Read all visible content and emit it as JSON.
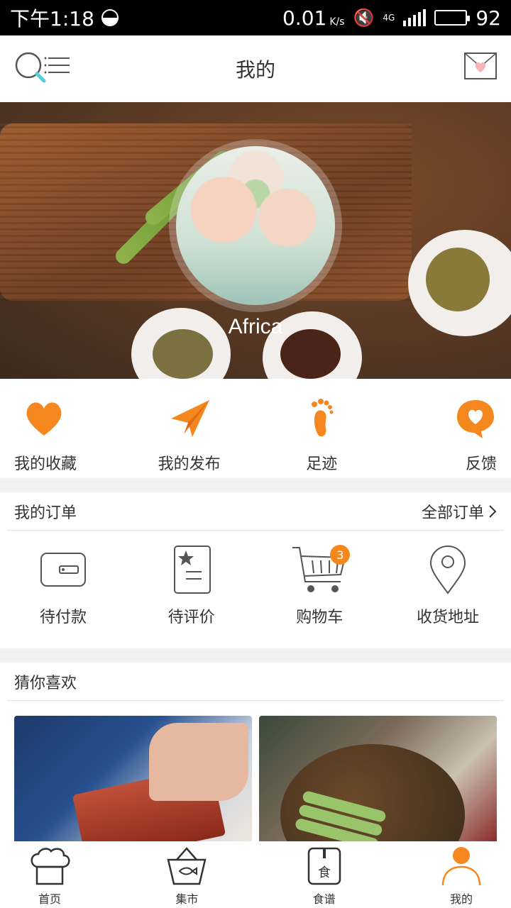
{
  "status_bar": {
    "time": "下午1:18",
    "speed_value": "0.01",
    "speed_unit": "K/s",
    "network": "4G",
    "battery": "92"
  },
  "header": {
    "title": "我的",
    "search_icon": "search-menu-icon",
    "mail_icon": "mail-heart-icon"
  },
  "profile": {
    "username": "Africa",
    "avatar_icon": "avatar-image"
  },
  "quick_actions": [
    {
      "label": "我的收藏",
      "icon": "heart-icon"
    },
    {
      "label": "我的发布",
      "icon": "paper-plane-icon"
    },
    {
      "label": "足迹",
      "icon": "footprint-icon"
    },
    {
      "label": "反馈",
      "icon": "feedback-heart-icon"
    }
  ],
  "orders": {
    "title": "我的订单",
    "all_label": "全部订单",
    "items": [
      {
        "label": "待付款",
        "icon": "wallet-icon"
      },
      {
        "label": "待评价",
        "icon": "review-doc-icon"
      },
      {
        "label": "购物车",
        "icon": "cart-icon",
        "badge": "3"
      },
      {
        "label": "收货地址",
        "icon": "location-pin-icon"
      }
    ]
  },
  "guess": {
    "title": "猜你喜欢"
  },
  "tabbar": {
    "items": [
      {
        "label": "首页",
        "icon": "chef-hat-icon"
      },
      {
        "label": "集市",
        "icon": "fish-basket-icon"
      },
      {
        "label": "食谱",
        "icon": "recipe-book-icon"
      },
      {
        "label": "我的",
        "icon": "person-icon"
      }
    ]
  },
  "colors": {
    "accent": "#f5871f",
    "icon_line": "#555555",
    "search_handle": "#4fd0d8"
  }
}
